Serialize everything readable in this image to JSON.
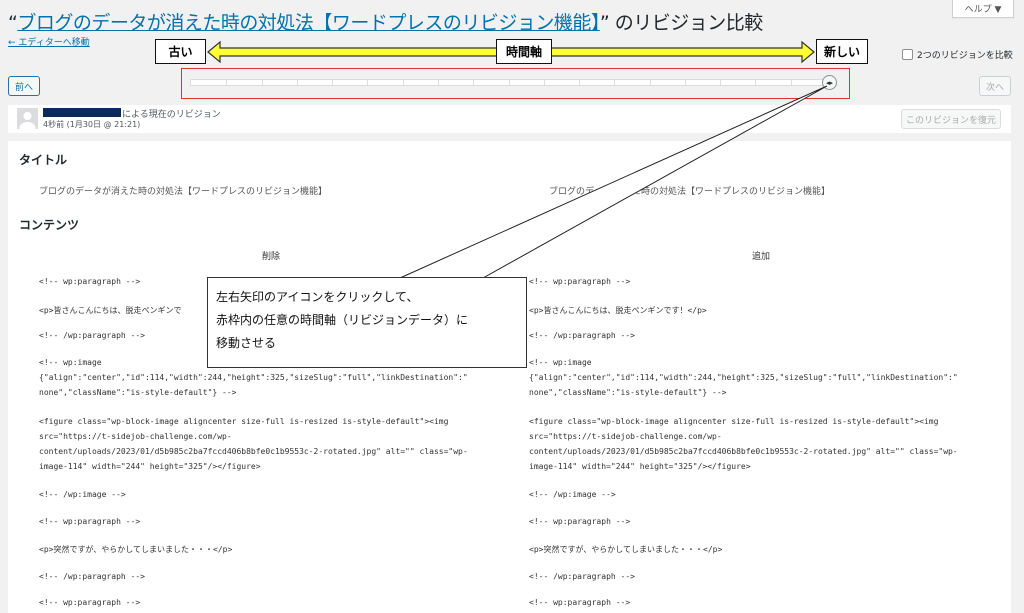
{
  "header": {
    "quote_open": "“",
    "post_title": "ブログのデータが消えた時の対処法【ワードプレスのリビジョン機能】",
    "title_suffix": "” のリビジョン比較",
    "back_link": "← エディターへ移動",
    "help_label": "ヘルプ ▼",
    "compare_label": "2つのリビジョンを比較"
  },
  "timeline": {
    "old_label": "古い",
    "axis_label": "時間軸",
    "new_label": "新しい",
    "prev_label": "前へ",
    "next_label": "次へ",
    "handle_glyph": "◂▸",
    "position": 1.0
  },
  "revision": {
    "author_suffix": "による現在のリビジョン",
    "time": "4秒前 (1月30日 @ 21:21)",
    "restore_label": "このリビジョンを復元"
  },
  "diff": {
    "title_heading": "タイトル",
    "title_left": "ブログのデータが消えた時の対処法【ワードプレスのリビジョン機能】",
    "title_right": "ブログのデ",
    "title_right_tail": "た時の対処法【ワードプレスのリビジョン機能】",
    "content_heading": "コンテンツ",
    "removed_label": "削除",
    "added_label": "追加",
    "left_lines": [
      "<!-- wp:paragraph -->",
      "<p>皆さんこんにちは、脱走ペンギンで",
      "<!-- /wp:paragraph -->",
      "<!-- wp:image\n{\"align\":\"center\",\"id\":114,\"width\":244,\"height\":325,\"sizeSlug\":\"full\",\"linkDestination\":\"\nnone\",\"className\":\"is-style-default\"} -->",
      "<figure class=\"wp-block-image aligncenter size-full is-resized is-style-default\"><img\nsrc=\"https://t-sidejob-challenge.com/wp-\ncontent/uploads/2023/01/d5b985c2ba7fccd406b8bfe0c1b9553c-2-rotated.jpg\" alt=\"\" class=\"wp-\nimage-114\" width=\"244\" height=\"325\"/></figure>",
      "<!-- /wp:image -->",
      "<!-- wp:paragraph -->",
      "<p>突然ですが、やらかしてしまいました・・・</p>",
      "<!-- /wp:paragraph -->",
      "<!-- wp:paragraph -->"
    ],
    "right_lines": [
      "<!-- wp:paragraph -->",
      "<p>皆さんこんにちは、脱走ペンギンです！</p>",
      "<!-- /wp:paragraph -->",
      "<!-- wp:image\n{\"align\":\"center\",\"id\":114,\"width\":244,\"height\":325,\"sizeSlug\":\"full\",\"linkDestination\":\"\nnone\",\"className\":\"is-style-default\"} -->",
      "<figure class=\"wp-block-image aligncenter size-full is-resized is-style-default\"><img\nsrc=\"https://t-sidejob-challenge.com/wp-\ncontent/uploads/2023/01/d5b985c2ba7fccd406b8bfe0c1b9553c-2-rotated.jpg\" alt=\"\" class=\"wp-\nimage-114\" width=\"244\" height=\"325\"/></figure>",
      "<!-- /wp:image -->",
      "<!-- wp:paragraph -->",
      "<p>突然ですが、やらかしてしまいました・・・</p>",
      "<!-- /wp:paragraph -->",
      "<!-- wp:paragraph -->"
    ]
  },
  "callout": {
    "line1": "左右矢印のアイコンをクリックして、",
    "line2": "赤枠内の任意の時間軸（リビジョンデータ）に",
    "line3": "移動させる"
  },
  "colors": {
    "accent": "#0073aa",
    "highlight_frame": "#e0303a",
    "arrow_fill": "#ffff33"
  }
}
